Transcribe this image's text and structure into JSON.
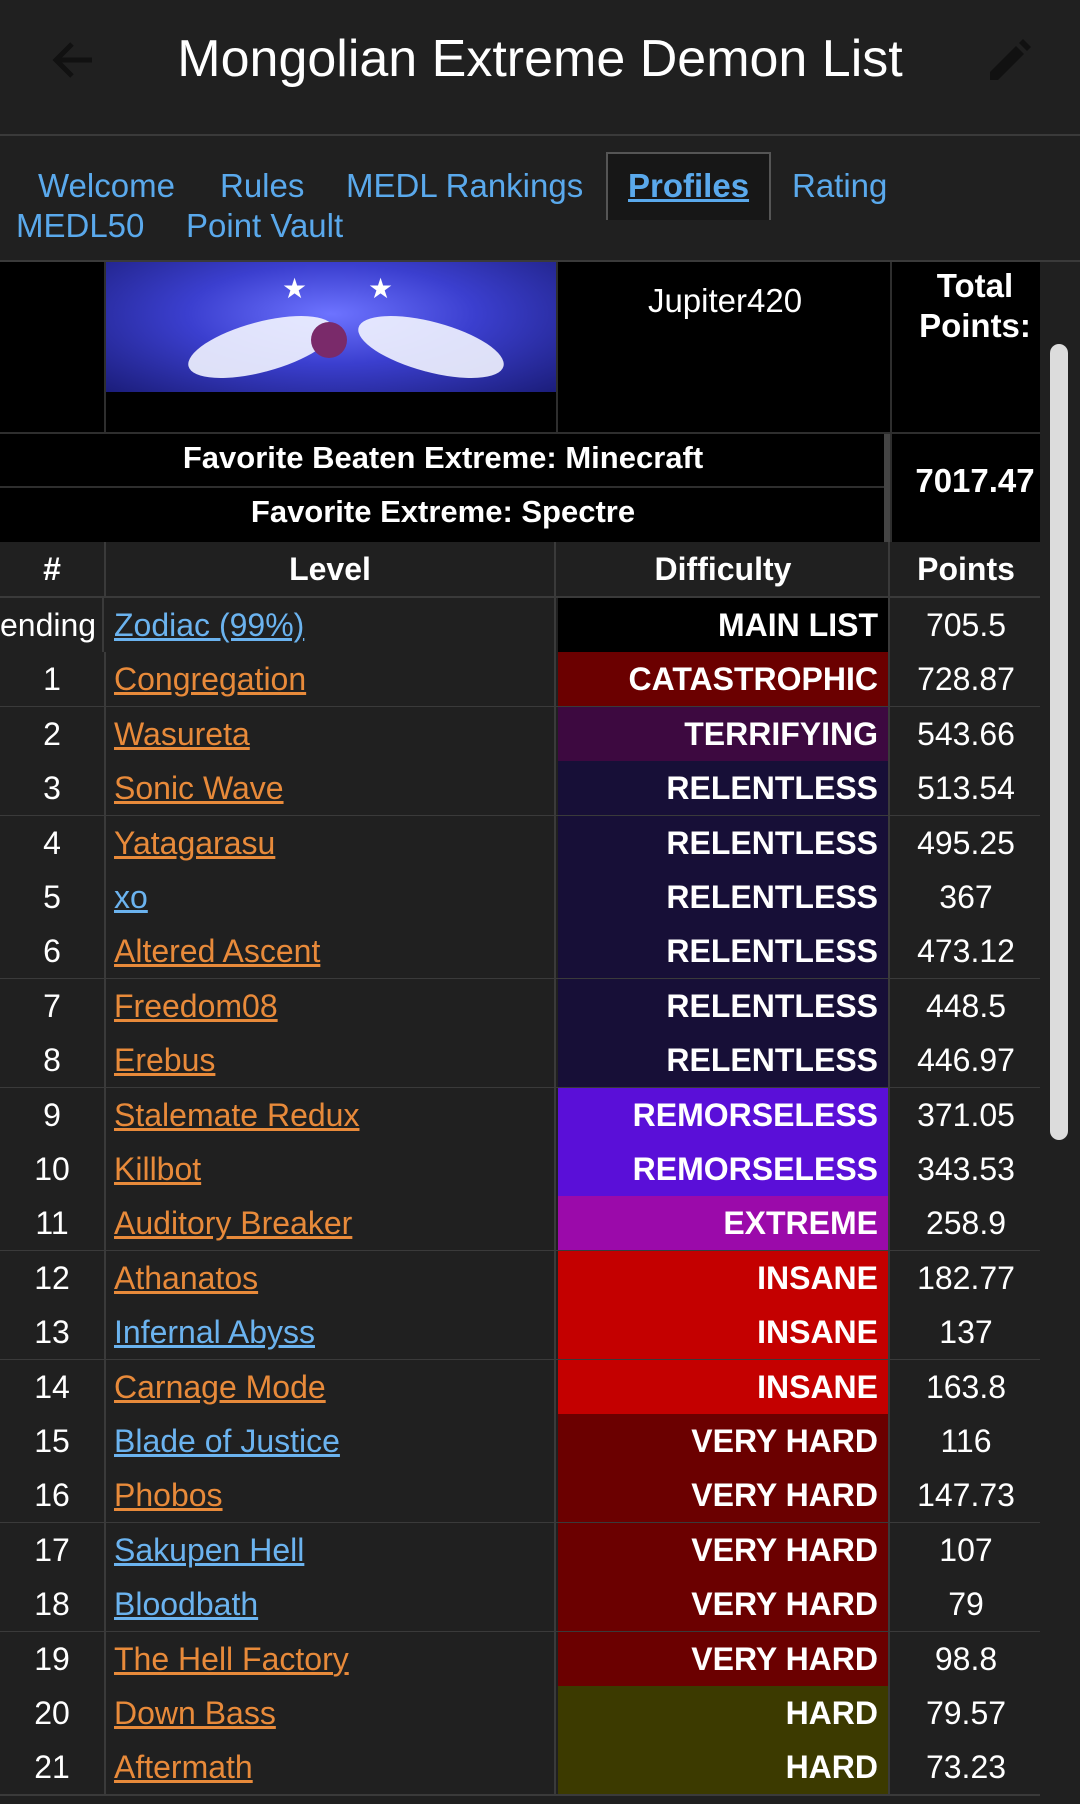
{
  "app": {
    "title": "Mongolian Extreme Demon List",
    "back_icon": "arrow-left-icon",
    "edit_icon": "pencil-icon"
  },
  "tabs": [
    {
      "label": "Welcome"
    },
    {
      "label": "Rules"
    },
    {
      "label": "MEDL Rankings"
    },
    {
      "label": "Profiles",
      "active": true
    },
    {
      "label": "Rating"
    },
    {
      "label": "MEDL50"
    },
    {
      "label": "Point Vault"
    }
  ],
  "profile": {
    "username": "Jupiter420",
    "total_points_label": "Total Points:",
    "total_points_value": "7017.47",
    "favorite_beaten": "Favorite Beaten Extreme: Minecraft",
    "favorite_extreme": "Favorite Extreme: Spectre"
  },
  "table": {
    "headers": {
      "num": "#",
      "level": "Level",
      "difficulty": "Difficulty",
      "points": "Points"
    },
    "rows": [
      {
        "num": "ending",
        "level": "Zodiac (99%)",
        "link_color": "blue",
        "difficulty": "MAIN LIST",
        "diff_color": "#000000",
        "points": "705.5"
      },
      {
        "num": "1",
        "level": "Congregation",
        "link_color": "orange",
        "difficulty": "CATASTROPHIC",
        "diff_color": "#6b0000",
        "points": "728.87"
      },
      {
        "num": "2",
        "level": "Wasureta",
        "link_color": "orange",
        "difficulty": "TERRIFYING",
        "diff_color": "#3d0940",
        "points": "543.66"
      },
      {
        "num": "3",
        "level": "Sonic Wave",
        "link_color": "orange",
        "difficulty": "RELENTLESS",
        "diff_color": "#170f37",
        "points": "513.54"
      },
      {
        "num": "4",
        "level": "Yatagarasu",
        "link_color": "orange",
        "difficulty": "RELENTLESS",
        "diff_color": "#170f37",
        "points": "495.25"
      },
      {
        "num": "5",
        "level": "xo",
        "link_color": "blue",
        "difficulty": "RELENTLESS",
        "diff_color": "#170f37",
        "points": "367"
      },
      {
        "num": "6",
        "level": "Altered Ascent",
        "link_color": "orange",
        "difficulty": "RELENTLESS",
        "diff_color": "#170f37",
        "points": "473.12"
      },
      {
        "num": "7",
        "level": "Freedom08",
        "link_color": "orange",
        "difficulty": "RELENTLESS",
        "diff_color": "#170f37",
        "points": "448.5"
      },
      {
        "num": "8",
        "level": "Erebus",
        "link_color": "orange",
        "difficulty": "RELENTLESS",
        "diff_color": "#170f37",
        "points": "446.97"
      },
      {
        "num": "9",
        "level": "Stalemate Redux",
        "link_color": "orange",
        "difficulty": "REMORSELESS",
        "diff_color": "#5a0fd8",
        "points": "371.05"
      },
      {
        "num": "10",
        "level": "Killbot",
        "link_color": "orange",
        "difficulty": "REMORSELESS",
        "diff_color": "#5a0fd8",
        "points": "343.53"
      },
      {
        "num": "11",
        "level": "Auditory Breaker",
        "link_color": "orange",
        "difficulty": "EXTREME",
        "diff_color": "#9b0aaa",
        "points": "258.9"
      },
      {
        "num": "12",
        "level": "Athanatos",
        "link_color": "orange",
        "difficulty": "INSANE",
        "diff_color": "#c40000",
        "points": "182.77"
      },
      {
        "num": "13",
        "level": "Infernal Abyss",
        "link_color": "blue",
        "difficulty": "INSANE",
        "diff_color": "#c40000",
        "points": "137"
      },
      {
        "num": "14",
        "level": "Carnage Mode",
        "link_color": "orange",
        "difficulty": "INSANE",
        "diff_color": "#c40000",
        "points": "163.8"
      },
      {
        "num": "15",
        "level": "Blade of Justice",
        "link_color": "blue",
        "difficulty": "VERY HARD",
        "diff_color": "#6b0000",
        "points": "116"
      },
      {
        "num": "16",
        "level": "Phobos",
        "link_color": "orange",
        "difficulty": "VERY HARD",
        "diff_color": "#6b0000",
        "points": "147.73"
      },
      {
        "num": "17",
        "level": "Sakupen Hell",
        "link_color": "blue",
        "difficulty": "VERY HARD",
        "diff_color": "#6b0000",
        "points": "107"
      },
      {
        "num": "18",
        "level": "Bloodbath",
        "link_color": "blue",
        "difficulty": "VERY HARD",
        "diff_color": "#6b0000",
        "points": "79"
      },
      {
        "num": "19",
        "level": "The Hell Factory",
        "link_color": "orange",
        "difficulty": "VERY HARD",
        "diff_color": "#6b0000",
        "points": "98.8"
      },
      {
        "num": "20",
        "level": "Down Bass",
        "link_color": "orange",
        "difficulty": "HARD",
        "diff_color": "#3c3a00",
        "points": "79.57"
      },
      {
        "num": "21",
        "level": "Aftermath",
        "link_color": "orange",
        "difficulty": "HARD",
        "diff_color": "#3c3a00",
        "points": "73.23"
      }
    ]
  }
}
